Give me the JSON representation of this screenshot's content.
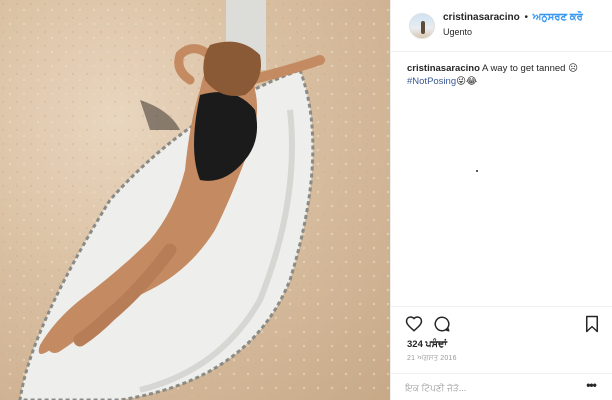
{
  "post": {
    "username": "cristinasaracino",
    "separator": "•",
    "follow_label": "ਅਨੁਸਰਣ ਕਰੋ",
    "location": "Ugento",
    "caption_user": "cristinasaracino",
    "caption_text": " A way to get tanned ☹",
    "caption_hashtag": "#NotPosing",
    "caption_emoji": "😜😂",
    "likes": "324 ਪਸੰਦਾਂ",
    "date": "21 ਅਗਸਤ 2016",
    "comment_placeholder": "ਇਕ ਟਿੱਪਣੀ ਜੋੜੋ...",
    "more_label": "•••"
  },
  "icons": {
    "like": "heart-icon",
    "comment": "comment-bubble-icon",
    "save": "bookmark-icon",
    "more": "more-options-icon"
  },
  "colors": {
    "link": "#3897f0",
    "hashtag": "#3b5998",
    "text": "#262626",
    "muted": "#999999",
    "sand": "#d9bfa1"
  }
}
